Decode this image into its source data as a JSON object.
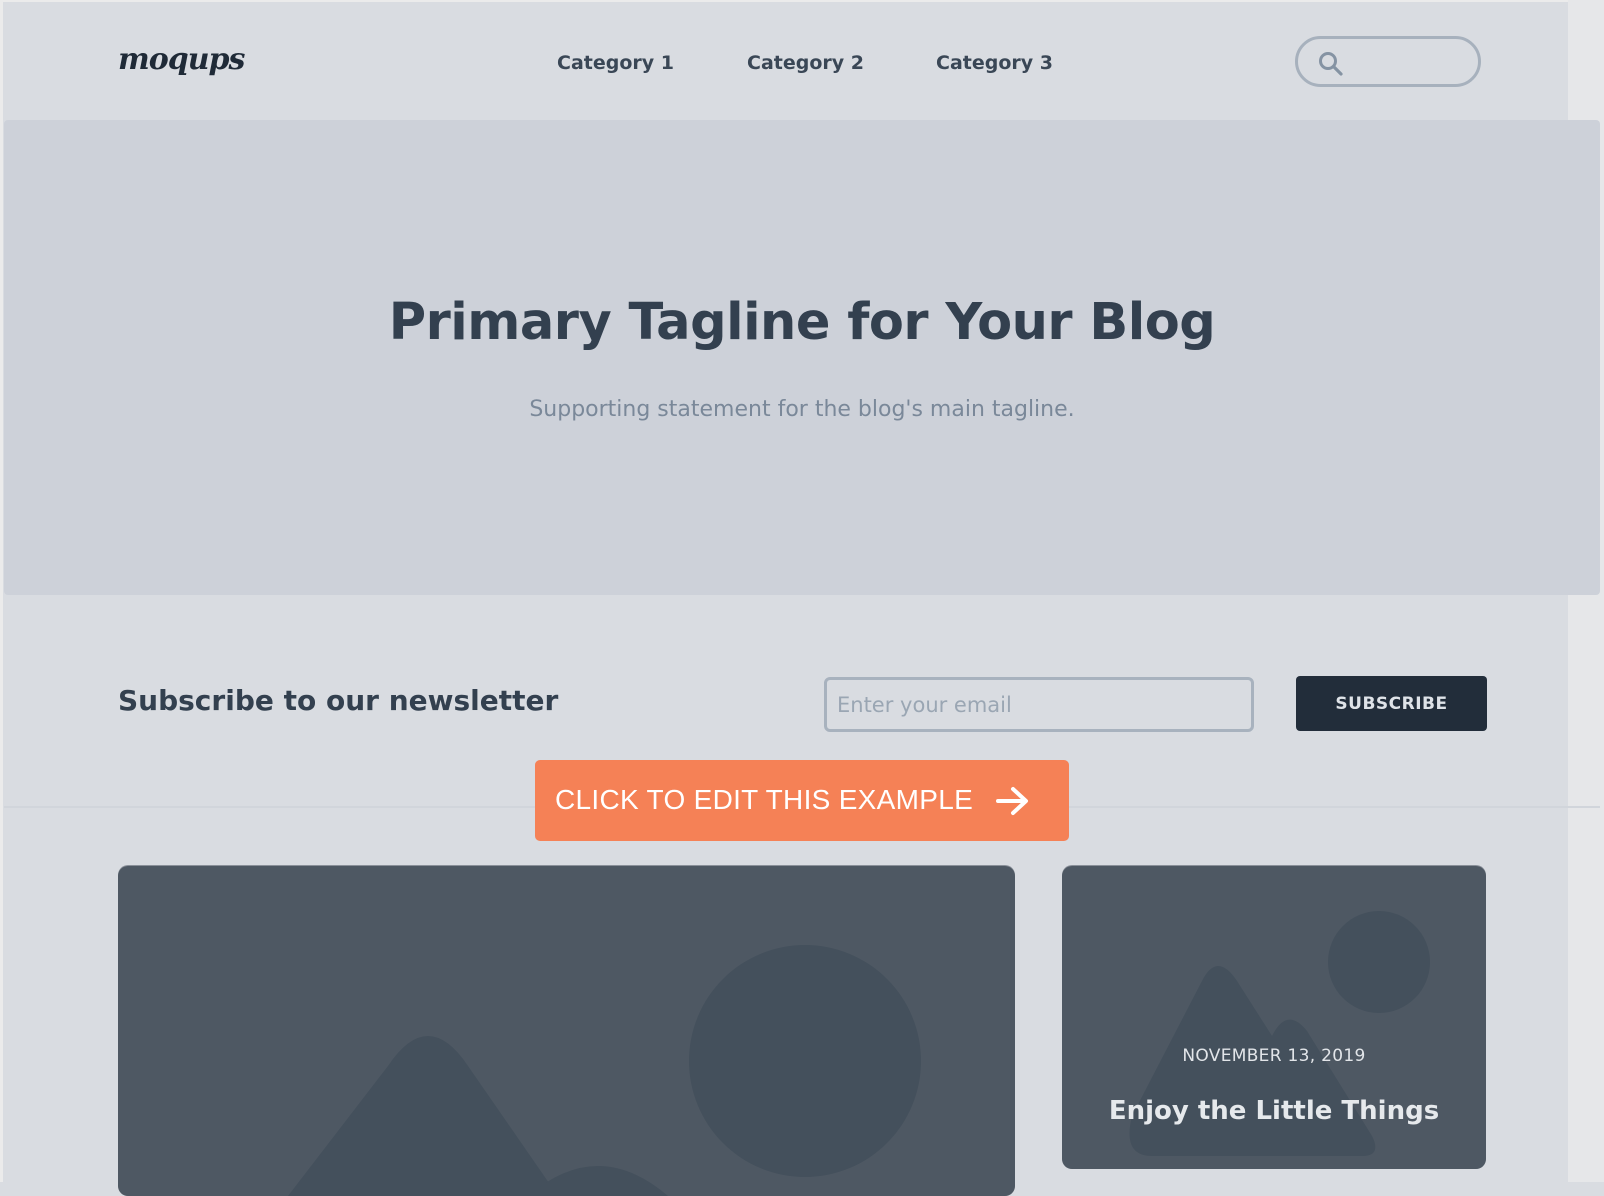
{
  "header": {
    "logo": "moqups",
    "nav": [
      {
        "label": "Category 1"
      },
      {
        "label": "Category 2"
      },
      {
        "label": "Category 3"
      }
    ],
    "search": {
      "placeholder": "",
      "value": "",
      "icon": "search-icon"
    }
  },
  "hero": {
    "title": "Primary Tagline for Your Blog",
    "subtitle": "Supporting statement for the blog's main tagline."
  },
  "newsletter": {
    "title": "Subscribe to our newsletter",
    "email_placeholder": "Enter your email",
    "email_value": "",
    "subscribe_label": "SUBSCRIBE"
  },
  "cta": {
    "label": "CLICK TO EDIT THIS EXAMPLE",
    "icon": "arrow-right-icon",
    "color": "#f58156"
  },
  "posts": [
    {
      "image_icon": "image-placeholder-icon"
    },
    {
      "image_icon": "image-placeholder-icon",
      "date": "NOVEMBER 13, 2019",
      "title": "Enjoy the Little Things"
    }
  ],
  "colors": {
    "page_bg": "#d9dce1",
    "hero_bg": "#cdd1d9",
    "text_dark": "#33404f",
    "button_dark": "#222d3a",
    "card_bg": "#4e5863",
    "accent": "#f58156"
  }
}
